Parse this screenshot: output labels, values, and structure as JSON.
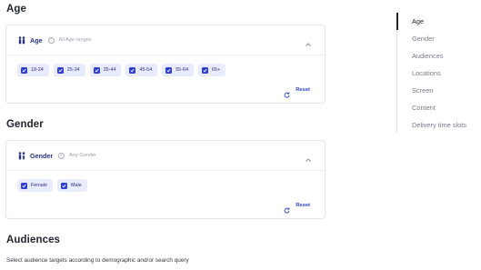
{
  "sections": {
    "age": {
      "title": "Age",
      "card_label": "Age",
      "card_hint": "All Age ranges",
      "options": [
        "18-24",
        "25-34",
        "35-44",
        "45-54",
        "55-64",
        "65+"
      ],
      "reset_label": "Reset"
    },
    "gender": {
      "title": "Gender",
      "card_label": "Gender",
      "card_hint": "Any Gender",
      "options": [
        "Female",
        "Male"
      ],
      "reset_label": "Reset"
    },
    "audiences": {
      "title": "Audiences",
      "subtitle": "Select audience targets according to demographic and/or search query"
    }
  },
  "toc": {
    "active": "Age",
    "items": [
      "Age",
      "Gender",
      "Audiences",
      "Locations",
      "Screen",
      "Content",
      "Delivery time slots"
    ]
  },
  "colors": {
    "accent": "#2e3fd1",
    "chip_bg": "#e9ecff",
    "label": "#2a3180"
  },
  "icons": {
    "age": "people-icon",
    "gender": "gender-icon",
    "info": "info-icon",
    "collapse": "chevron-up-icon",
    "checkbox": "checkbox-checked-icon",
    "reset": "refresh-icon"
  }
}
